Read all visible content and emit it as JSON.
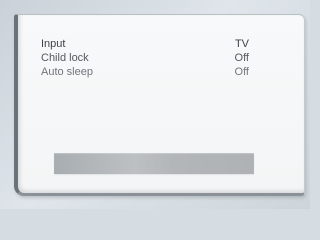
{
  "menu": {
    "items": [
      {
        "label": "Input",
        "value": "TV"
      },
      {
        "label": "Child lock",
        "value": "Off"
      },
      {
        "label": "Auto sleep",
        "value": "Off"
      }
    ]
  },
  "status_bar": {
    "text": ""
  },
  "colors": {
    "panel": "#f5f7f8",
    "text": "#55595d",
    "bar": "#b0b4b7"
  }
}
